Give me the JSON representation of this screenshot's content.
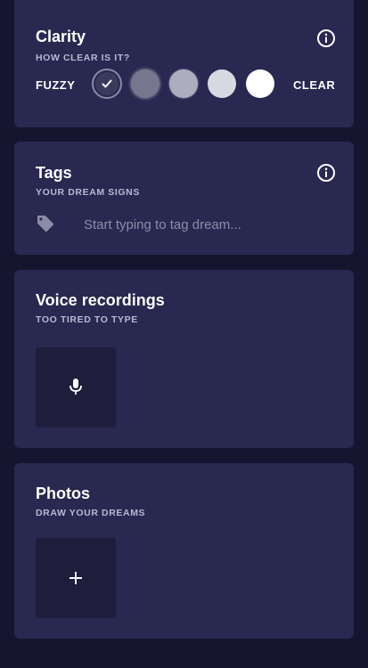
{
  "mood_dots": [
    {
      "color": "#17c7d8",
      "style": "ring"
    },
    {
      "color": "#ffffff",
      "style": "fill"
    },
    {
      "color": "#f0a7e8",
      "style": "fill"
    },
    {
      "color": "#e455e0",
      "style": "fill"
    },
    {
      "color": "#ff1fe0",
      "style": "fill"
    }
  ],
  "clarity": {
    "title": "Clarity",
    "subtitle": "HOW CLEAR IS IT?",
    "low_label": "FUZZY",
    "high_label": "CLEAR",
    "options": [
      {
        "color": "#3a3a5c",
        "selected": true
      },
      {
        "color": "#77768f",
        "selected": false
      },
      {
        "color": "#aeadbf",
        "selected": false
      },
      {
        "color": "#d9d9e3",
        "selected": false
      },
      {
        "color": "#ffffff",
        "selected": false
      }
    ]
  },
  "tags": {
    "title": "Tags",
    "subtitle": "YOUR DREAM SIGNS",
    "placeholder": "Start typing to tag dream...",
    "icon": "tag-icon"
  },
  "voice": {
    "title": "Voice recordings",
    "subtitle": "TOO TIRED TO TYPE",
    "icon": "microphone-icon"
  },
  "photos": {
    "title": "Photos",
    "subtitle": "DRAW YOUR DREAMS",
    "icon": "plus-icon"
  },
  "colors": {
    "background": "#161530",
    "card": "#282850",
    "tile": "#1e1d3c",
    "subtitle": "#b9b8d3"
  }
}
